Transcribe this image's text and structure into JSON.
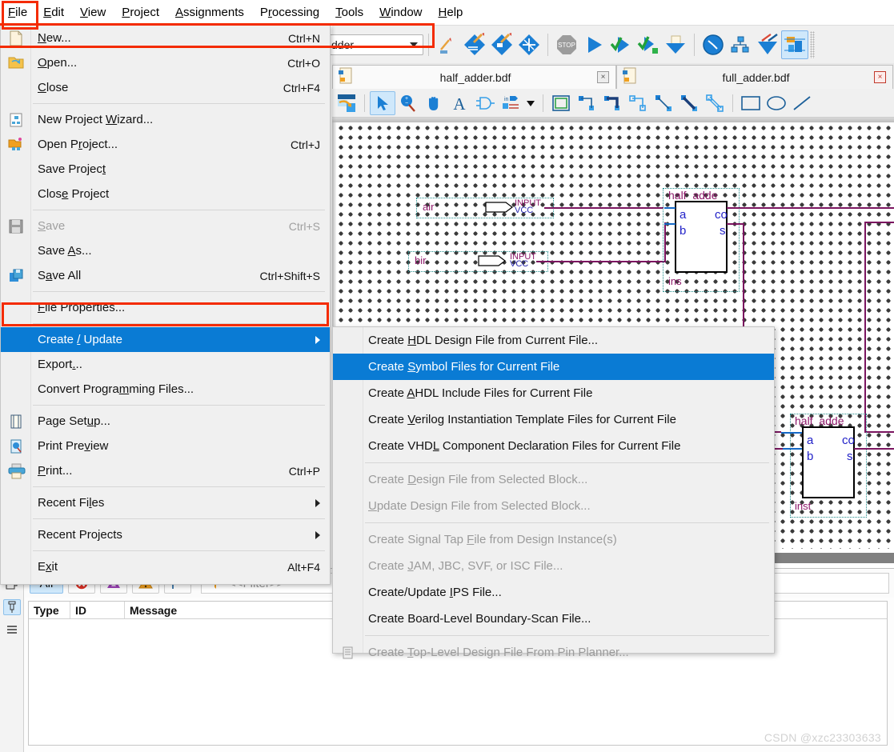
{
  "app": {
    "title": "Quartus Schematic Editor"
  },
  "menubar": {
    "items": [
      {
        "label": "File",
        "mnemonic": "F"
      },
      {
        "label": "Edit",
        "mnemonic": "E"
      },
      {
        "label": "View",
        "mnemonic": "V"
      },
      {
        "label": "Project",
        "mnemonic": "P"
      },
      {
        "label": "Assignments",
        "mnemonic": "A"
      },
      {
        "label": "Processing",
        "mnemonic": "r"
      },
      {
        "label": "Tools",
        "mnemonic": "T"
      },
      {
        "label": "Window",
        "mnemonic": "W"
      },
      {
        "label": "Help",
        "mnemonic": "H"
      }
    ]
  },
  "toolbar": {
    "combo_value": "dder",
    "buttons": [
      "pencil-compile-icon",
      "compile-design-icon",
      "analysis-synthesis-icon",
      "fitter-icon",
      "stop-icon",
      "start-compilation-icon",
      "start-analysis-elaboration-icon",
      "start-analysis-synthesis-icon",
      "assembler-icon",
      "timing-analyzer-icon",
      "netlist-viewer-icon",
      "programmer-icon",
      "chip-planner-icon"
    ],
    "selected_button": "chip-planner-icon"
  },
  "tabs": [
    {
      "label": "half_adder.bdf",
      "active": true,
      "close_label": "×"
    },
    {
      "label": "full_adder.bdf",
      "active": false,
      "close_label": "×"
    }
  ],
  "schematic_toolbar": {
    "buttons": [
      "open-file-icon",
      "selection-tool-icon",
      "zoom-tool-icon",
      "hand-tool-icon",
      "text-tool-icon",
      "symbol-tool-icon",
      "pin-tool-icon",
      "pin-dropdown-icon",
      "block-tool-icon",
      "orthogonal-node-tool-icon",
      "orthogonal-bus-tool-icon",
      "orthogonal-conduit-tool-icon",
      "diagonal-node-tool-icon",
      "diagonal-bus-tool-icon",
      "diagonal-conduit-tool-icon",
      "rectangle-tool-icon",
      "oval-tool-icon",
      "line-tool-icon"
    ],
    "selected_button": "selection-tool-icon"
  },
  "canvas": {
    "inputs": [
      {
        "name": "air",
        "type": "INPUT",
        "default": "VCC"
      },
      {
        "name": "bir",
        "type": "INPUT",
        "default": "VCC"
      }
    ],
    "blocks": [
      {
        "title": "half_adde",
        "instance": "ins",
        "in_ports": [
          "a",
          "b"
        ],
        "out_ports": [
          "co",
          "s"
        ]
      },
      {
        "title": "half_adde",
        "instance": "inst",
        "in_ports": [
          "a",
          "b"
        ],
        "out_ports": [
          "co",
          "s"
        ]
      }
    ]
  },
  "file_menu": {
    "groups": [
      {
        "items": [
          {
            "label": "New...",
            "ul_index": 0,
            "accel": "Ctrl+N",
            "icon": "new-file-icon",
            "disabled": false,
            "submenu": false
          },
          {
            "label": "Open...",
            "ul_index": 0,
            "accel": "Ctrl+O",
            "icon": "open-folder-icon",
            "disabled": false,
            "submenu": false
          },
          {
            "label": "Close",
            "ul_index": 0,
            "accel": "Ctrl+F4",
            "icon": "",
            "disabled": false,
            "submenu": false
          }
        ]
      },
      {
        "items": [
          {
            "label": "New Project Wizard...",
            "ul_index": 12,
            "accel": "",
            "icon": "new-project-wizard-icon",
            "disabled": false,
            "submenu": false
          },
          {
            "label": "Open Project...",
            "ul_index": 6,
            "accel": "Ctrl+J",
            "icon": "open-project-icon",
            "disabled": false,
            "submenu": false
          },
          {
            "label": "Save Project",
            "ul_index": 11,
            "accel": "",
            "icon": "",
            "disabled": false,
            "submenu": false
          },
          {
            "label": "Close Project",
            "ul_index": 4,
            "accel": "",
            "icon": "",
            "disabled": false,
            "submenu": false
          }
        ]
      },
      {
        "items": [
          {
            "label": "Save",
            "ul_index": 0,
            "accel": "Ctrl+S",
            "icon": "save-disk-icon",
            "disabled": true,
            "submenu": false
          },
          {
            "label": "Save As...",
            "ul_index": 5,
            "accel": "",
            "icon": "",
            "disabled": false,
            "submenu": false
          },
          {
            "label": "Save All",
            "ul_index": 1,
            "accel": "Ctrl+Shift+S",
            "icon": "save-all-icon",
            "disabled": false,
            "submenu": false
          }
        ]
      },
      {
        "items": [
          {
            "label": "File Properties...",
            "ul_index": 0,
            "accel": "",
            "icon": "",
            "disabled": false,
            "submenu": false
          }
        ]
      },
      {
        "items": [
          {
            "label": "Create / Update",
            "ul_index": 9,
            "accel": "",
            "icon": "",
            "disabled": false,
            "submenu": true,
            "highlight": true
          },
          {
            "label": "Export...",
            "ul_index": 6,
            "accel": "",
            "icon": "",
            "disabled": false,
            "submenu": false
          },
          {
            "label": "Convert Programming Files...",
            "ul_index": 18,
            "accel": "",
            "icon": "",
            "disabled": false,
            "submenu": false
          }
        ]
      },
      {
        "items": [
          {
            "label": "Page Setup...",
            "ul_index": 7,
            "accel": "",
            "icon": "page-setup-icon",
            "disabled": false,
            "submenu": false
          },
          {
            "label": "Print Preview",
            "ul_index": 10,
            "accel": "",
            "icon": "print-preview-icon",
            "disabled": false,
            "submenu": false
          },
          {
            "label": "Print...",
            "ul_index": 0,
            "accel": "Ctrl+P",
            "icon": "print-icon",
            "disabled": false,
            "submenu": false
          }
        ]
      },
      {
        "items": [
          {
            "label": "Recent Files",
            "ul_index": 9,
            "accel": "",
            "icon": "",
            "disabled": false,
            "submenu": true
          }
        ]
      },
      {
        "items": [
          {
            "label": "Recent Projects",
            "ul_index": 0,
            "accel": "",
            "icon": "",
            "disabled": false,
            "submenu": true
          }
        ]
      },
      {
        "items": [
          {
            "label": "Exit",
            "ul_index": 1,
            "accel": "Alt+F4",
            "icon": "",
            "disabled": false,
            "submenu": false
          }
        ]
      }
    ]
  },
  "submenu": {
    "groups": [
      {
        "items": [
          {
            "label": "Create HDL Design File from Current File...",
            "disabled": false,
            "highlight": false
          },
          {
            "label": "Create Symbol Files for Current File",
            "disabled": false,
            "highlight": true
          },
          {
            "label": "Create AHDL Include Files for Current File",
            "disabled": false,
            "highlight": false
          },
          {
            "label": "Create Verilog Instantiation Template Files for Current File",
            "disabled": false,
            "highlight": false
          },
          {
            "label": "Create VHDL Component Declaration Files for Current File",
            "disabled": false,
            "highlight": false
          }
        ]
      },
      {
        "items": [
          {
            "label": "Create Design File from Selected Block...",
            "disabled": true,
            "highlight": false
          },
          {
            "label": "Update Design File from Selected Block...",
            "disabled": true,
            "highlight": false
          }
        ]
      },
      {
        "items": [
          {
            "label": "Create Signal Tap File from Design Instance(s)",
            "disabled": true,
            "highlight": false
          },
          {
            "label": "Create JAM, JBC, SVF, or ISC File...",
            "disabled": true,
            "highlight": false
          },
          {
            "label": "Create/Update IPS File...",
            "disabled": false,
            "highlight": false
          },
          {
            "label": "Create Board-Level Boundary-Scan File...",
            "disabled": false,
            "highlight": false
          }
        ]
      },
      {
        "items": [
          {
            "label": "Create Top-Level Design File From Pin Planner...",
            "disabled": true,
            "highlight": false,
            "icon": "pin-planner-icon"
          }
        ]
      }
    ]
  },
  "messages_panel": {
    "side_buttons": [
      "restore-icon",
      "pin-icon",
      "menu-icon"
    ],
    "filter_buttons": [
      {
        "label": "All",
        "name": "all-messages-button",
        "selected": true
      },
      {
        "label": "",
        "name": "error-filter-button",
        "icon": "error-icon",
        "selected": false
      },
      {
        "label": "",
        "name": "critical-warning-filter-button",
        "icon": "critical-warning-icon",
        "selected": false
      },
      {
        "label": "",
        "name": "warning-filter-button",
        "icon": "warning-icon",
        "selected": false
      },
      {
        "label": "",
        "name": "info-filter-button",
        "icon": "flag-icon",
        "selected": false
      }
    ],
    "filter_placeholder": "<<Filter>>",
    "columns": [
      "Type",
      "ID",
      "Message"
    ],
    "rows": []
  },
  "watermark": {
    "text": "CSDN @xzc23303633"
  },
  "colors": {
    "highlight": "#0a7bd4",
    "redbox": "#f42b00",
    "wire": "#7b1560",
    "port": "#2222c8",
    "label": "#8e1a6b",
    "selection_blue": "#cfe8fb"
  }
}
